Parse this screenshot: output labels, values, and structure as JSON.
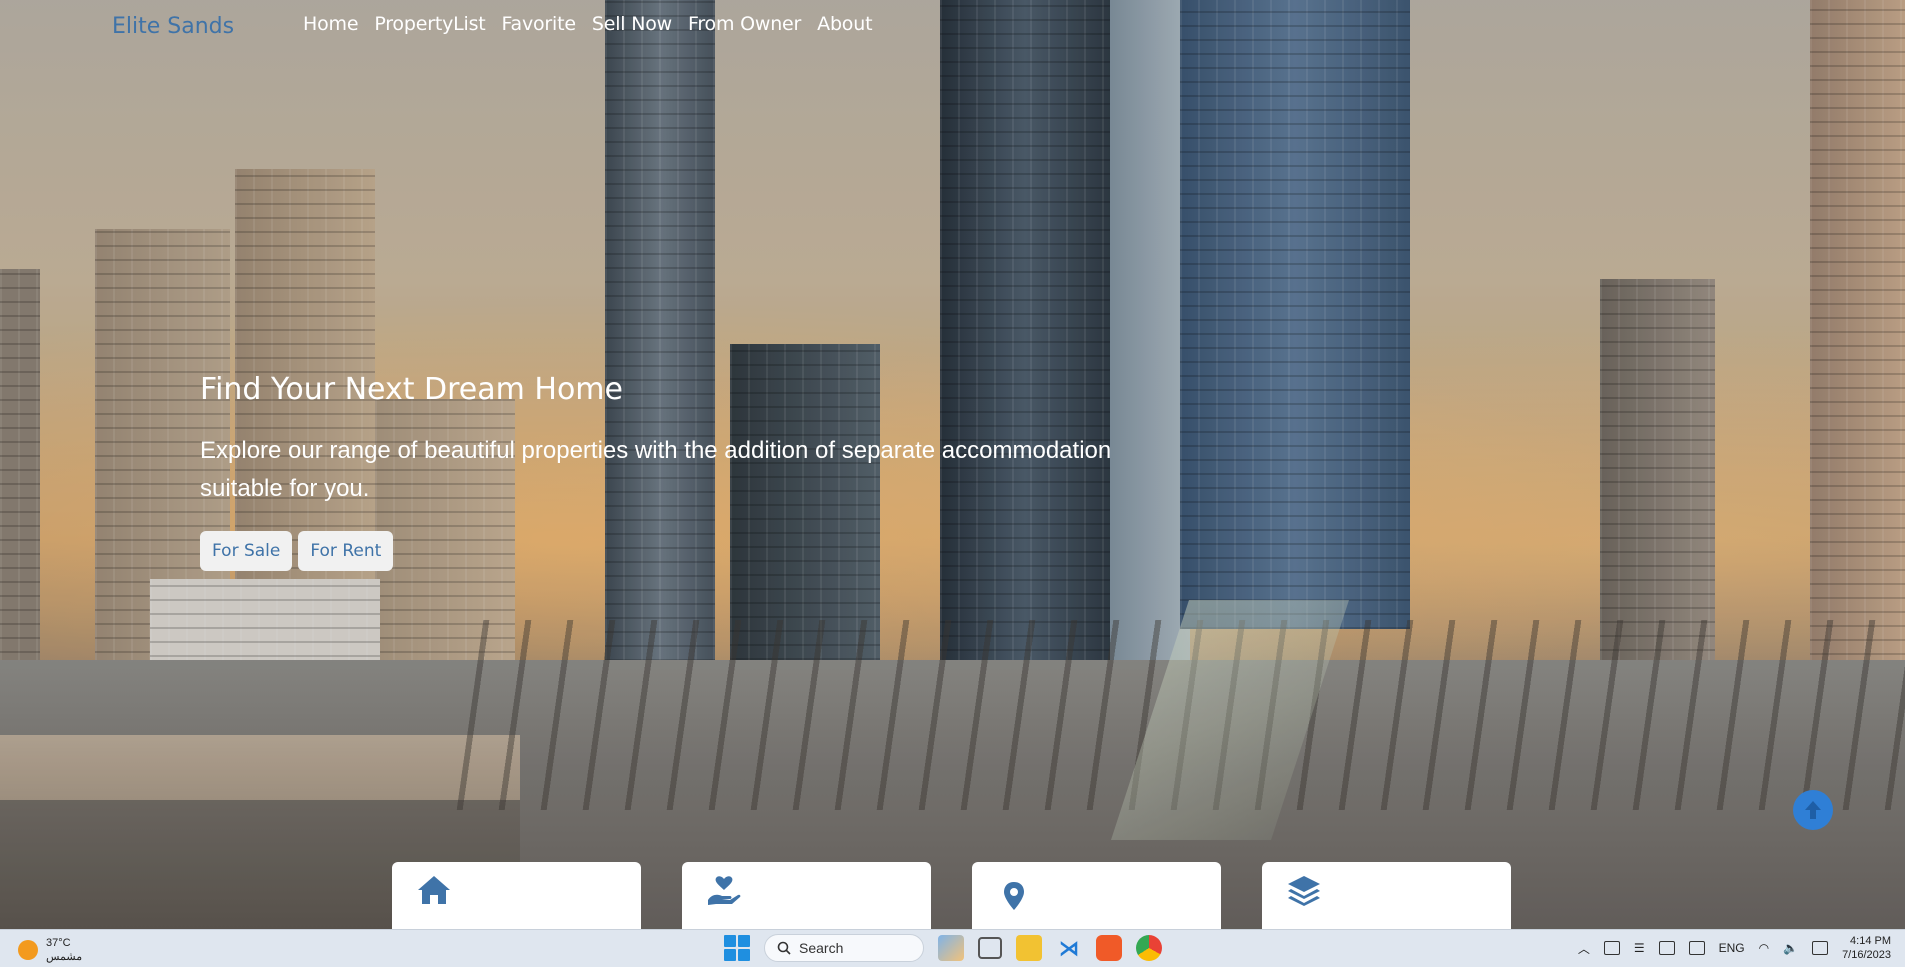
{
  "brand": "Elite Sands",
  "nav": {
    "items": [
      "Home",
      "PropertyList",
      "Favorite",
      "Sell Now",
      "From Owner",
      "About"
    ]
  },
  "hero": {
    "title": "Find Your Next Dream Home",
    "subtitle": "Explore our range of beautiful properties with the addition of separate accommodation suitable for you.",
    "buttons": [
      "For Sale",
      "For Rent"
    ]
  },
  "cards": [
    {
      "icon": "home-icon"
    },
    {
      "icon": "hand-heart-icon"
    },
    {
      "icon": "map-pin-icon"
    },
    {
      "icon": "layers-icon"
    }
  ],
  "taskbar": {
    "weather_temp": "37°C",
    "weather_desc": "مشمس",
    "search_label": "Search",
    "language": "ENG",
    "time": "4:14 PM",
    "date": "7/16/2023"
  },
  "colors": {
    "brand": "#3f73a8",
    "scroll_top_button": "#2f7fd6"
  }
}
